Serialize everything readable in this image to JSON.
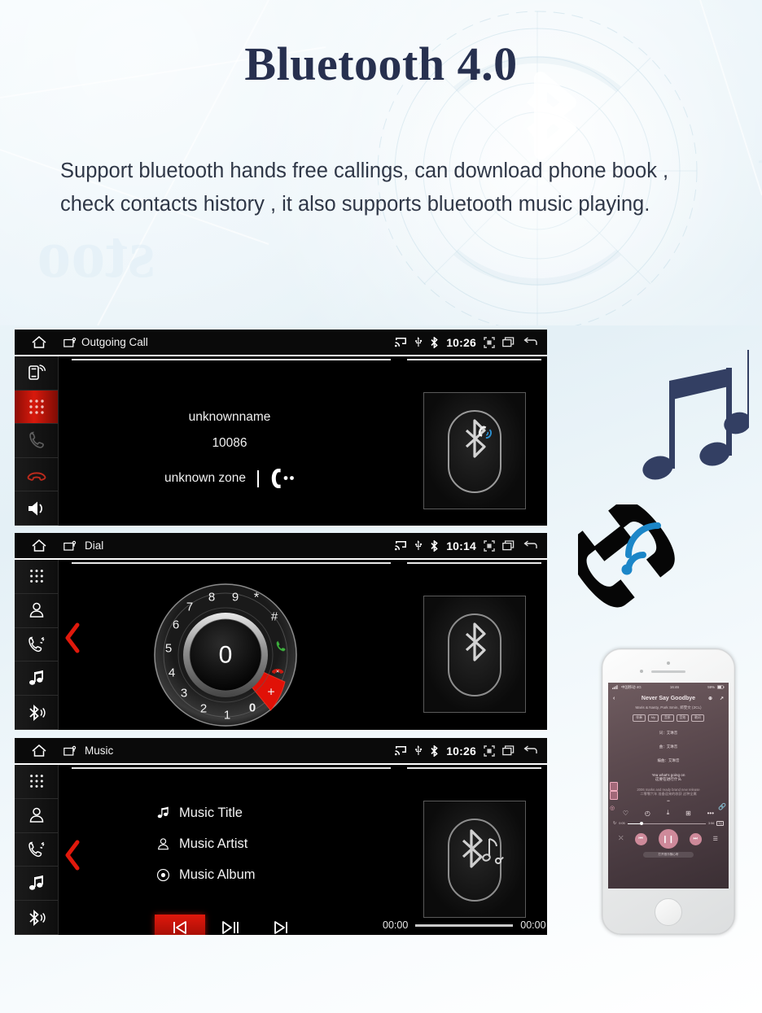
{
  "page": {
    "title": "Bluetooth 4.0",
    "description": "Support bluetooth hands free callings, can download phone book , check contacts history , it also supports bluetooth music playing."
  },
  "colors": {
    "title_navy": "#27304f",
    "body_text": "#2f3747",
    "accent_red": "#d8190c",
    "bluetooth_blue": "#1b86c8",
    "phone_pink": "#f4a0b4",
    "screen_black": "#000000"
  },
  "screens": [
    {
      "id": "outgoing-call",
      "statusbar": {
        "home_icon": "home-icon",
        "app_icon": "screen-cast-app-icon",
        "app_title": "Outgoing Call",
        "icons_left": [
          "cast-icon",
          "usb-icon",
          "bluetooth-icon"
        ],
        "clock": "10:26",
        "icons_right": [
          "screenshot-icon",
          "recent-apps-icon",
          "back-icon"
        ]
      },
      "sidebar": [
        {
          "name": "phone-link-icon",
          "label": "Phone Link",
          "state": "normal"
        },
        {
          "name": "dialpad-icon",
          "label": "Dial Pad",
          "state": "active"
        },
        {
          "name": "call-icon",
          "label": "Answer",
          "state": "disabled"
        },
        {
          "name": "hangup-icon",
          "label": "Hang Up",
          "state": "red"
        },
        {
          "name": "speaker-icon",
          "label": "Speaker",
          "state": "normal"
        }
      ],
      "call": {
        "name": "unknownname",
        "number": "10086",
        "zone": "unknown zone",
        "status_icon": "in-call-handset-icon"
      },
      "art": {
        "name": "bluetooth-call-art",
        "label": "Bluetooth Calling"
      }
    },
    {
      "id": "dial",
      "statusbar": {
        "home_icon": "home-icon",
        "app_icon": "screen-cast-app-icon",
        "app_title": "Dial",
        "icons_left": [
          "cast-icon",
          "usb-icon",
          "bluetooth-icon"
        ],
        "clock": "10:14",
        "icons_right": [
          "screenshot-icon",
          "recent-apps-icon",
          "back-icon"
        ]
      },
      "sidebar": [
        {
          "name": "dialpad-icon",
          "label": "Dial Pad",
          "state": "normal"
        },
        {
          "name": "contacts-icon",
          "label": "Contacts",
          "state": "normal"
        },
        {
          "name": "call-history-icon",
          "label": "Call History",
          "state": "normal"
        },
        {
          "name": "music-icon",
          "label": "Music",
          "state": "normal"
        },
        {
          "name": "bluetooth-icon",
          "label": "Bluetooth",
          "state": "normal"
        }
      ],
      "nav_chevron": "chevron-left-icon",
      "dial": {
        "center_value": "0",
        "keys": [
          "8",
          "9",
          "*",
          "#",
          "+",
          "0",
          "1",
          "2",
          "3",
          "4",
          "5",
          "6",
          "7"
        ],
        "selected_key": "0",
        "call_key": "call-icon",
        "end_key": "end-call-icon"
      },
      "art": {
        "name": "bluetooth-art",
        "label": "Bluetooth"
      }
    },
    {
      "id": "music",
      "statusbar": {
        "home_icon": "home-icon",
        "app_icon": "screen-cast-app-icon",
        "app_title": "Music",
        "icons_left": [
          "cast-icon",
          "usb-icon",
          "bluetooth-icon"
        ],
        "clock": "10:26",
        "icons_right": [
          "screenshot-icon",
          "recent-apps-icon",
          "back-icon"
        ]
      },
      "sidebar": [
        {
          "name": "dialpad-icon",
          "label": "Dial Pad",
          "state": "normal"
        },
        {
          "name": "contacts-icon",
          "label": "Contacts",
          "state": "normal"
        },
        {
          "name": "call-history-icon",
          "label": "Call History",
          "state": "normal"
        },
        {
          "name": "music-icon",
          "label": "Music",
          "state": "normal"
        },
        {
          "name": "bluetooth-icon",
          "label": "Bluetooth",
          "state": "normal"
        }
      ],
      "nav_chevron": "chevron-left-icon",
      "track": {
        "title": "Music Title",
        "artist": "Music Artist",
        "album": "Music Album",
        "title_icon": "music-note-icon",
        "artist_icon": "person-icon",
        "album_icon": "disc-icon"
      },
      "controls": {
        "previous": "previous-track-icon",
        "play_pause": "play-pause-icon",
        "next": "next-track-icon",
        "active": "previous"
      },
      "progress": {
        "elapsed": "00:00",
        "total": "00:00",
        "percent": 0
      },
      "art": {
        "name": "bluetooth-music-art",
        "label": "Bluetooth Music"
      }
    }
  ],
  "decorations": {
    "music_notes": "music-notes-graphic",
    "phone_wifi": "phone-handset-wifi-graphic"
  },
  "phone_mockup": {
    "device": "white-smartphone",
    "status": {
      "carrier": "中国移动 4G",
      "time": "16:46",
      "battery": "59%"
    },
    "nav": {
      "back": "back-icon",
      "title": "Never Say Goodbye",
      "add": "add-icon",
      "share": "share-icon"
    },
    "subtitle": "Maris & Nasty, Park Smin, 郑雯文 (2CL)",
    "chips": [
      "伴奏",
      "My",
      "音质",
      "音效",
      "歌词"
    ],
    "credits": [
      "词：艾琳音",
      "曲：艾琳音",
      "编曲：艾琳音"
    ],
    "lyrics": {
      "current_en": "Yea what's going on",
      "current_cn": "这要在进行什么",
      "next_en": "2006 marks and ready brand new release",
      "next_cn": "二零零六年 准备迎来的收获 这种全属"
    },
    "actions": [
      "heart-icon",
      "comment-icon",
      "download-icon",
      "playlist-add-icon",
      "more-icon"
    ],
    "seek": {
      "elapsed": "0:05",
      "total": "3:56",
      "quality": "SQ"
    },
    "transport": {
      "shuffle": "shuffle-icon",
      "prev": "previous-track-icon",
      "play_pause": "pause-icon",
      "next": "next-track-icon",
      "queue": "queue-icon"
    },
    "bottom_pill": "打开音乐随心听"
  }
}
